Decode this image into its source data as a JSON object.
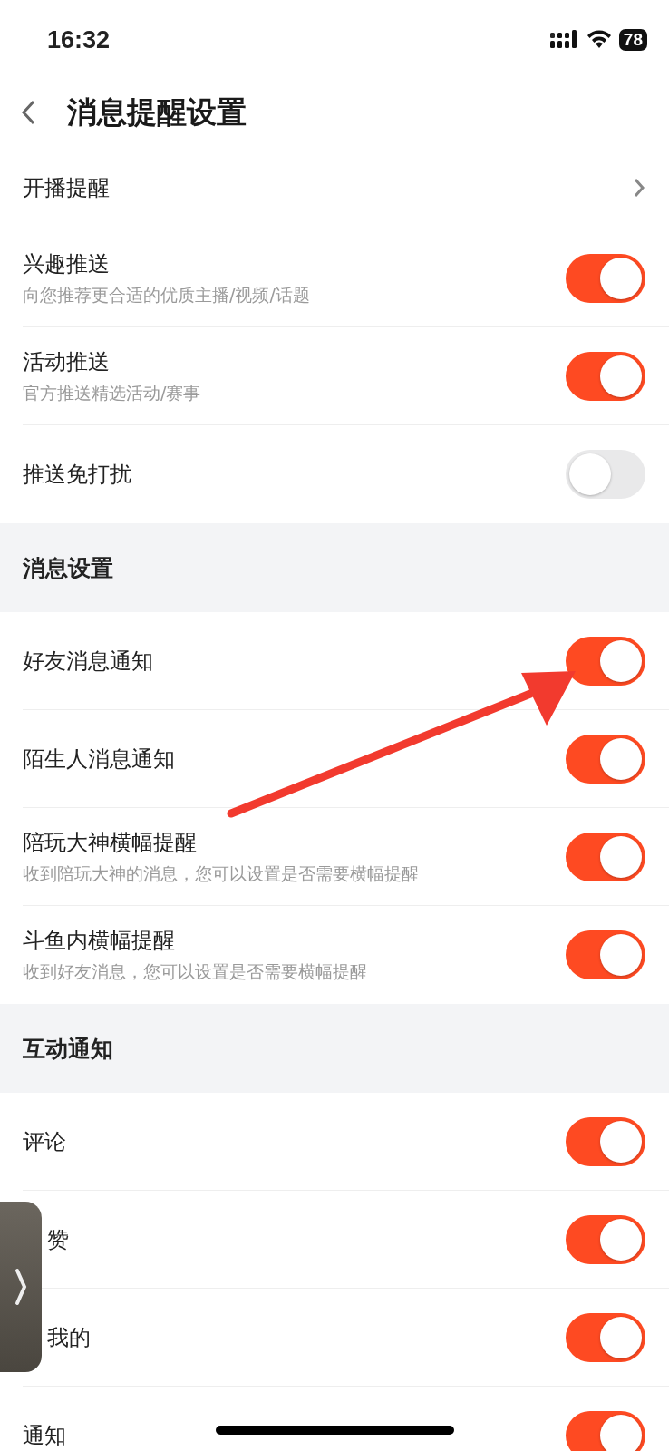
{
  "status_bar": {
    "time": "16:32",
    "battery": "78"
  },
  "nav": {
    "title": "消息提醒设置"
  },
  "sections": [
    {
      "rows": [
        {
          "kind": "link",
          "title": "开播提醒"
        },
        {
          "kind": "toggle",
          "title": "兴趣推送",
          "subtitle": "向您推荐更合适的优质主播/视频/话题",
          "on": true
        },
        {
          "kind": "toggle",
          "title": "活动推送",
          "subtitle": "官方推送精选活动/赛事",
          "on": true
        },
        {
          "kind": "toggle",
          "title": "推送免打扰",
          "on": false
        }
      ]
    },
    {
      "header": "消息设置",
      "rows": [
        {
          "kind": "toggle",
          "title": "好友消息通知",
          "on": true
        },
        {
          "kind": "toggle",
          "title": "陌生人消息通知",
          "on": true
        },
        {
          "kind": "toggle",
          "title": "陪玩大神横幅提醒",
          "subtitle": "收到陪玩大神的消息，您可以设置是否需要横幅提醒",
          "on": true
        },
        {
          "kind": "toggle",
          "title": "斗鱼内横幅提醒",
          "subtitle": "收到好友消息，您可以设置是否需要横幅提醒",
          "on": true
        }
      ]
    },
    {
      "header": "互动通知",
      "rows": [
        {
          "kind": "toggle",
          "title": "评论",
          "on": true
        },
        {
          "kind": "toggle",
          "title": "赞",
          "covered": true,
          "on": true
        },
        {
          "kind": "toggle",
          "title": "我的",
          "covered": true,
          "on": true
        },
        {
          "kind": "toggle",
          "title": "通知",
          "on": true
        }
      ]
    }
  ]
}
